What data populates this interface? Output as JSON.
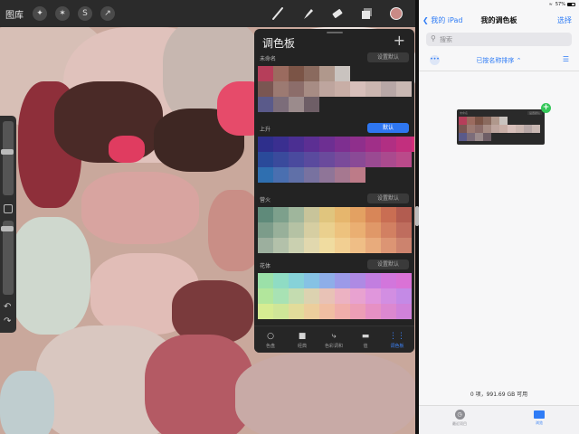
{
  "procreate": {
    "topbar": {
      "gallery_label": "图库",
      "action_icons": [
        "wrench-icon",
        "magic-wand-icon",
        "selection-icon",
        "transform-arrow-icon"
      ],
      "tool_icons": [
        "brush-icon",
        "smudge-icon",
        "eraser-icon",
        "layers-icon"
      ],
      "current_color": "#c98a86"
    },
    "palettes_panel": {
      "title": "调色板",
      "add_symbol": "+",
      "palettes": [
        {
          "name": "未命名",
          "button": "设置默认",
          "is_default": false,
          "rows": [
            [
              "#b63e5a",
              "#9b6b5f",
              "#7b5446",
              "#8a6a5e",
              "#b0988c",
              "#c9c3bf"
            ],
            [
              "#7a5652",
              "#9c7a72",
              "#8c6d6a",
              "#a78c84",
              "#bea59e",
              "#c8aea6",
              "#d7bfba",
              "#cbb6b0",
              "#b7a7a6",
              "#c9b8b3"
            ],
            [
              "#5a5a8a",
              "#7c6d7a",
              "#9b8b8c",
              "#6e5e66"
            ]
          ]
        },
        {
          "name": "上升",
          "button": "默认",
          "is_default": true,
          "rows": [
            [
              "#2e2f8c",
              "#3a2f90",
              "#4b2f92",
              "#5c2f93",
              "#6d2f92",
              "#7e2f90",
              "#8f2f8c",
              "#a02f88",
              "#b12f83",
              "#c22f7e",
              "#d32f79"
            ],
            [
              "#2a4a9a",
              "#3a4a9c",
              "#4a4a9e",
              "#5a4a9e",
              "#6a4a9c",
              "#7a4a9a",
              "#8a4a96",
              "#9a4a92",
              "#aa4a8e",
              "#ba4a8a"
            ],
            [
              "#2f6fb0",
              "#4a6fb0",
              "#6070a8",
              "#7872a0",
              "#8f7598",
              "#a67890",
              "#bd7b88"
            ]
          ]
        },
        {
          "name": "营火",
          "button": "设置默认",
          "is_default": false,
          "rows": [
            [
              "#5f8a7a",
              "#7da08c",
              "#9fb69c",
              "#c8c49a",
              "#e0c57e",
              "#e6b66d",
              "#e3a162",
              "#d88658",
              "#c96e53",
              "#b25c50"
            ],
            [
              "#7c9c8a",
              "#98b09a",
              "#b5c2a4",
              "#d6cea2",
              "#ead08e",
              "#edc27e",
              "#eaaf72",
              "#e09868",
              "#d28062",
              "#bf6d5e"
            ],
            [
              "#9caf9e",
              "#b3c1aa",
              "#cad0b0",
              "#e1d8ae",
              "#f0dca0",
              "#f2cf92",
              "#efbe86",
              "#e8ab7c",
              "#dc9574",
              "#cc836e"
            ]
          ]
        },
        {
          "name": "花体",
          "button": "设置默认",
          "is_default": false,
          "rows": [
            [
              "#9be0a8",
              "#8fdcc4",
              "#86d2d8",
              "#86c2e4",
              "#8eaee8",
              "#9c9ae8",
              "#ae8ae4",
              "#c27ee0",
              "#d276dc",
              "#da72d6"
            ],
            [
              "#b2e69c",
              "#a8e2b4",
              "#c4dcb0",
              "#dcd2b0",
              "#e8c2b6",
              "#ecb2c2",
              "#e8a2d0",
              "#e096dc",
              "#d28ee2",
              "#c48ae6"
            ],
            [
              "#d6ec92",
              "#cfe698",
              "#e2dc9a",
              "#ecce9c",
              "#f0bea2",
              "#f0aeaa",
              "#ec9eb6",
              "#e690c4",
              "#dc88d0",
              "#d082da"
            ]
          ]
        }
      ],
      "tabs": [
        {
          "icon": "disc-icon",
          "label": "色盘",
          "active": false
        },
        {
          "icon": "classic-square-icon",
          "label": "经典",
          "active": false
        },
        {
          "icon": "harmony-icon",
          "label": "色彩调和",
          "active": false
        },
        {
          "icon": "value-sliders-icon",
          "label": "值",
          "active": false
        },
        {
          "icon": "palettes-grid-icon",
          "label": "调色板",
          "active": true
        }
      ]
    }
  },
  "files": {
    "status": {
      "battery_text": "57%",
      "battery_level": 0.57
    },
    "nav": {
      "back_label": "我的 iPad",
      "title": "我的调色板",
      "select_label": "选择"
    },
    "search": {
      "placeholder": "搜索"
    },
    "sort_label": "已按名称排序",
    "storage_text": "0 项，991.69 GB 可用",
    "tabs": [
      {
        "label": "最近项目",
        "active": false
      },
      {
        "label": "浏览",
        "active": true
      }
    ]
  }
}
